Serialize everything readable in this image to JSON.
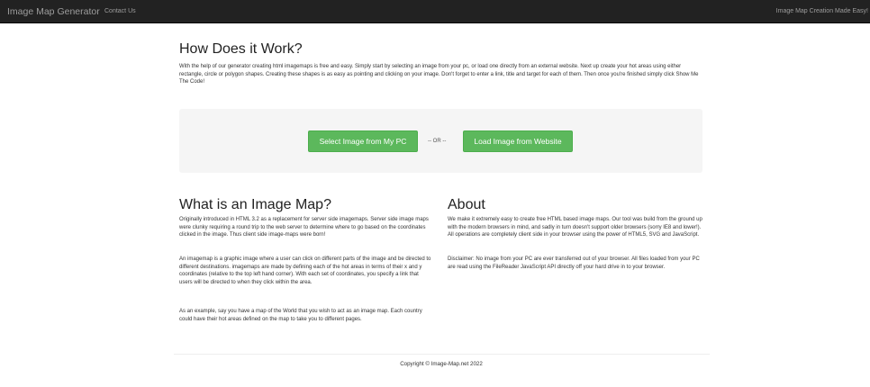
{
  "navbar": {
    "brand": "Image Map Generator",
    "links": [
      {
        "label": "Contact Us"
      }
    ],
    "tagline": "Image Map Creation Made Easy!"
  },
  "how": {
    "title": "How Does it Work?",
    "text": "With the help of our generator creating html imagemaps is free and easy. Simply start by selecting an image from your pc, or load one directly from an external website. Next up create your hot areas using either rectangle, circle or polygon shapes. Creating these shapes is as easy as pointing and clicking on your image. Don't forget to enter a link, title and target for each of them. Then once you're finished simply click Show Me The Code!"
  },
  "actions": {
    "select_pc": "Select Image from My PC",
    "or": "-- OR --",
    "load_web": "Load Image from Website",
    "button_color": "#5cb85c"
  },
  "what": {
    "title": "What is an Image Map?",
    "paragraphs": [
      "Originally introduced in HTML 3.2 as a replacement for server side imagemaps. Server side image maps were clunky requiring a round trip to the web server to determine where to go based on the coordinates clicked in the image. Thus client side image-maps were born!",
      "An imagemap is a graphic image where a user can click on different parts of the image and be directed to different destinations. imagemaps are made by defining each of the hot areas in terms of their x and y coordinates (relative to the top left hand corner). With each set of coordinates, you specify a link that users will be directed to when they click within the area.",
      "As an example, say you have a map of the World that you wish to act as an image map. Each country could have their hot areas defined on the map to take you to different pages."
    ]
  },
  "about": {
    "title": "About",
    "paragraphs": [
      "We make it extremely easy to create free HTML based image maps. Our tool was build from the ground up with the modern browsers in mind, and sadly in turn doesn't support older browsers (sorry IE8 and lower!). All operations are completely client side in your browser using the power of HTML5, SVG and JavaScript.",
      "Disclaimer: No image from your PC are ever transferred out of your browser. All files loaded from your PC are read using the FileReader JavaScript API directly off your hard drive in to your browser."
    ]
  },
  "footer": {
    "copyright": "Copyright © Image-Map.net 2022"
  }
}
